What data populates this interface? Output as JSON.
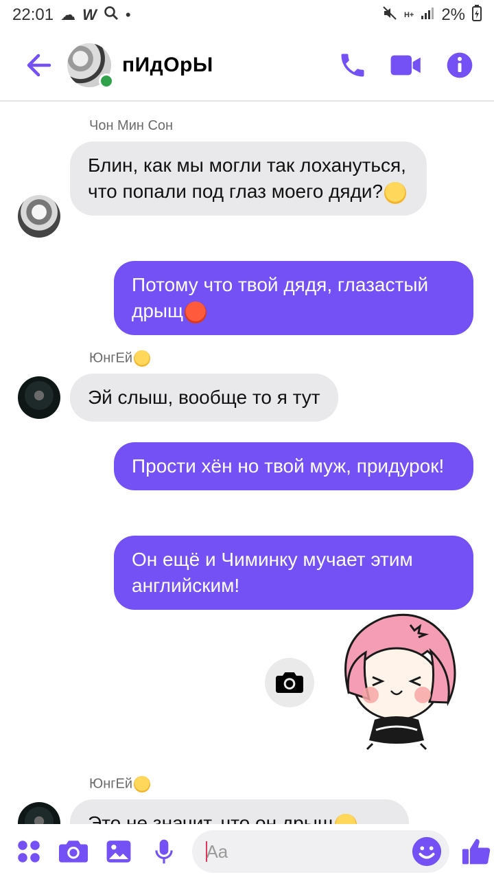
{
  "status_bar": {
    "time": "22:01",
    "left_icons": [
      "cloud-icon",
      "w-app-icon",
      "search-icon",
      "dot-icon"
    ],
    "network_label": "H+",
    "battery": "2%"
  },
  "header": {
    "title": "пИдОрЫ",
    "online": true,
    "accent_color": "#7351f5"
  },
  "messages": [
    {
      "type": "incoming",
      "sender": "Чон Мин Сон",
      "text": "Блин, как мы могли так лохануться, что попали под глаз моего дяди?",
      "emoji": "worried-face"
    },
    {
      "type": "outgoing",
      "text": "Потому что твой дядя, глазастый дрыщ",
      "emoji": "angry-face"
    },
    {
      "type": "incoming",
      "sender": "ЮнгЕй",
      "sender_emoji": "laughing-face",
      "text": "Эй слыш, вообще то я тут"
    },
    {
      "type": "outgoing",
      "text": "Прости хён  но твой муж, придурок!"
    },
    {
      "type": "outgoing",
      "text": "Он ещё и Чиминку мучает этим английским!"
    },
    {
      "type": "sticker",
      "description": "angry-girl-sticker"
    },
    {
      "type": "incoming",
      "sender": "ЮнгЕй",
      "sender_emoji": "laughing-face",
      "text": "Это не значит, что он дрыщ",
      "emoji": "expressionless-face",
      "partial": true
    }
  ],
  "composer": {
    "placeholder": "Aa",
    "icons": [
      "more-apps-icon",
      "camera-icon",
      "gallery-icon",
      "microphone-icon",
      "emoji-icon",
      "like-icon"
    ]
  }
}
